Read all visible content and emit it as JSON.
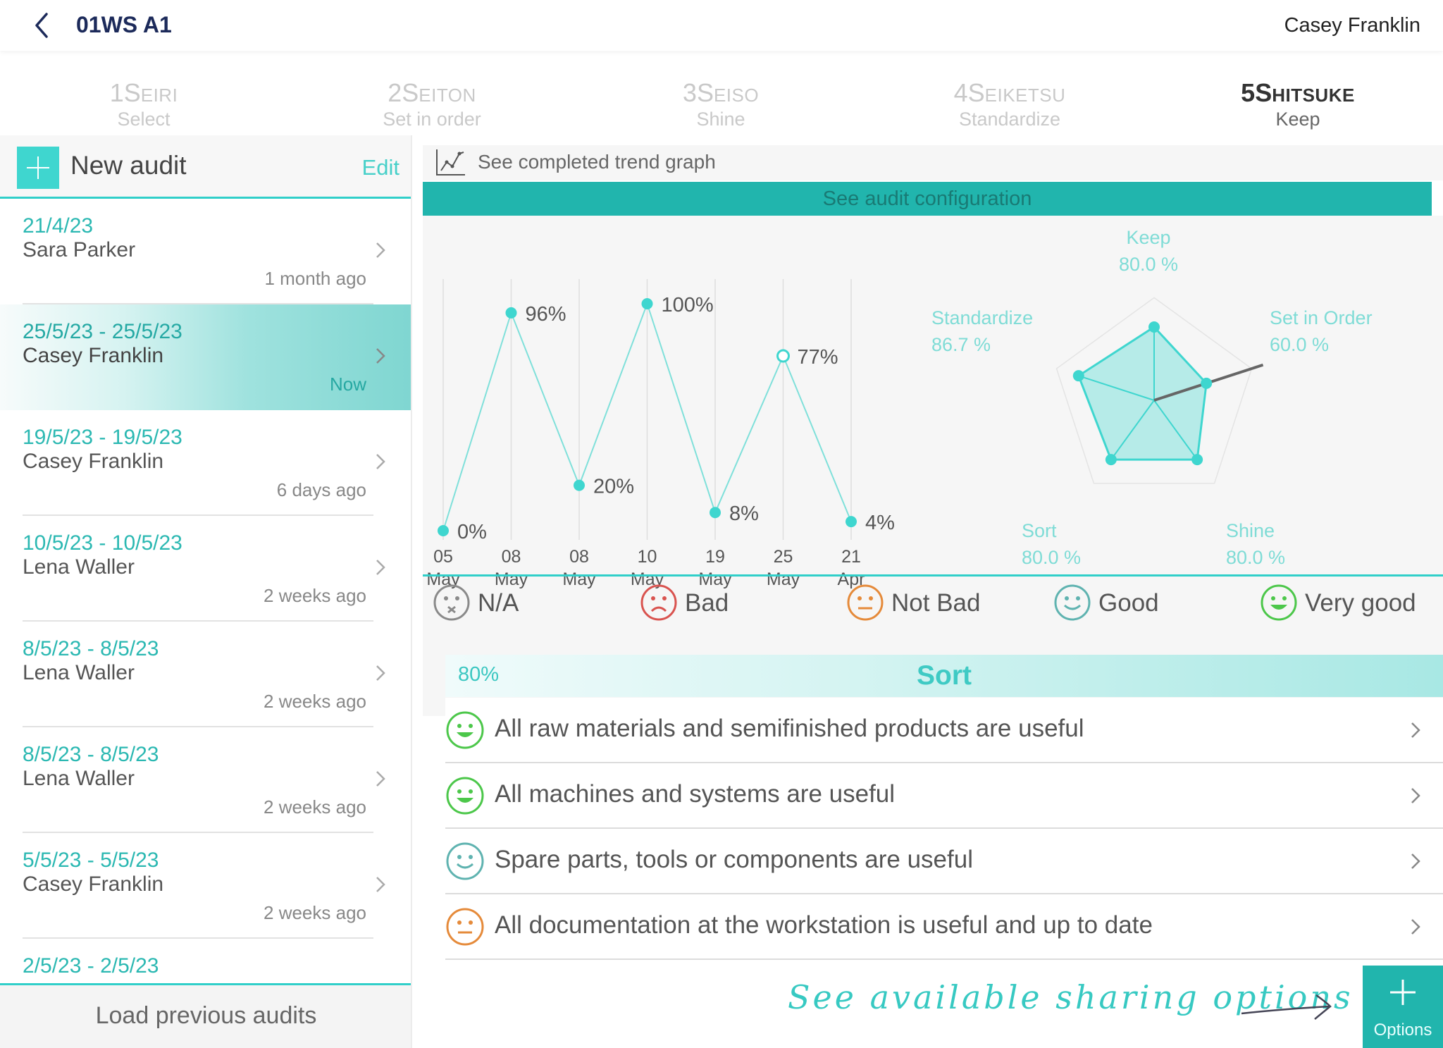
{
  "header": {
    "back_icon": "chevron-left-icon",
    "title": "01WS A1",
    "user": "Casey Franklin"
  },
  "steps": [
    {
      "num": "1",
      "s": "S",
      "rest": "EIRI",
      "sub": "Select",
      "active": false
    },
    {
      "num": "2",
      "s": "S",
      "rest": "EITON",
      "sub": "Set in order",
      "active": false
    },
    {
      "num": "3",
      "s": "S",
      "rest": "EISO",
      "sub": "Shine",
      "active": false
    },
    {
      "num": "4",
      "s": "S",
      "rest": "EIKETSU",
      "sub": "Standardize",
      "active": false
    },
    {
      "num": "5",
      "s": "S",
      "rest": "HITSUKE",
      "sub": "Keep",
      "active": true
    }
  ],
  "left": {
    "new_audit": "New audit",
    "edit": "Edit",
    "audits": [
      {
        "date": "21/4/23",
        "name": "Sara Parker",
        "ago": "1 month ago"
      },
      {
        "date": "25/5/23 - 25/5/23",
        "name": "Casey Franklin",
        "ago": "Now",
        "selected": true
      },
      {
        "date": "19/5/23 - 19/5/23",
        "name": "Casey Franklin",
        "ago": "6 days ago"
      },
      {
        "date": "10/5/23 - 10/5/23",
        "name": "Lena Waller",
        "ago": "2 weeks ago"
      },
      {
        "date": "8/5/23 - 8/5/23",
        "name": "Lena Waller",
        "ago": "2 weeks ago"
      },
      {
        "date": "8/5/23 - 8/5/23",
        "name": "Lena Waller",
        "ago": "2 weeks ago"
      },
      {
        "date": "5/5/23 - 5/5/23",
        "name": "Casey Franklin",
        "ago": "2 weeks ago"
      },
      {
        "date": "2/5/23 - 2/5/23",
        "name": "",
        "ago": ""
      }
    ],
    "load_previous": "Load previous audits"
  },
  "right": {
    "trend_link": "See completed trend graph",
    "trend_icon": "line-chart-icon",
    "config": "See audit configuration"
  },
  "chart_data": [
    {
      "type": "line",
      "categories": [
        "05 May",
        "08 May",
        "08 May",
        "10 May",
        "19 May",
        "25 May",
        "21 Apr"
      ],
      "x_day": [
        "05",
        "08",
        "08",
        "10",
        "19",
        "25",
        "21"
      ],
      "x_month": [
        "May",
        "May",
        "May",
        "May",
        "May",
        "May",
        "Apr"
      ],
      "values": [
        0,
        96,
        20,
        100,
        8,
        77,
        4
      ],
      "labels": [
        "0%",
        "96%",
        "20%",
        "100%",
        "8%",
        "77%",
        "4%"
      ],
      "highlighted_index": 5,
      "ylim": [
        0,
        100
      ],
      "color": "#3fd6cf"
    },
    {
      "type": "radar",
      "axes": [
        "Keep",
        "Set in Order",
        "Shine",
        "Sort",
        "Standardize"
      ],
      "values": [
        80.0,
        60.0,
        80.0,
        80.0,
        86.7
      ],
      "value_labels": [
        "80.0 %",
        "60.0 %",
        "80.0 %",
        "80.0 %",
        "86.7 %"
      ],
      "color": "#3fd6cf"
    }
  ],
  "legend": [
    {
      "label": "N/A",
      "face": "na-face-icon",
      "color": "#8a8a8a"
    },
    {
      "label": "Bad",
      "face": "sad-face-icon",
      "color": "#d9534f"
    },
    {
      "label": "Not Bad",
      "face": "neutral-face-icon",
      "color": "#e58a3a"
    },
    {
      "label": "Good",
      "face": "smile-face-icon",
      "color": "#5fb3b0"
    },
    {
      "label": "Very good",
      "face": "grin-face-icon",
      "color": "#4cc74a"
    }
  ],
  "sort": {
    "percent": "80%",
    "title": "Sort",
    "questions": [
      {
        "text": "All raw materials and semifinished products are useful",
        "rating": "very-good"
      },
      {
        "text": "All machines and systems are useful",
        "rating": "very-good"
      },
      {
        "text": "Spare parts, tools or components are useful",
        "rating": "good"
      },
      {
        "text": "All documentation at the workstation is useful and up to date",
        "rating": "not-bad"
      }
    ]
  },
  "share_hint": "See available sharing options",
  "options": "Options",
  "colors": {
    "accent": "#3fd6cf",
    "accent_dark": "#21b5ad",
    "title": "#1c2a5a"
  }
}
